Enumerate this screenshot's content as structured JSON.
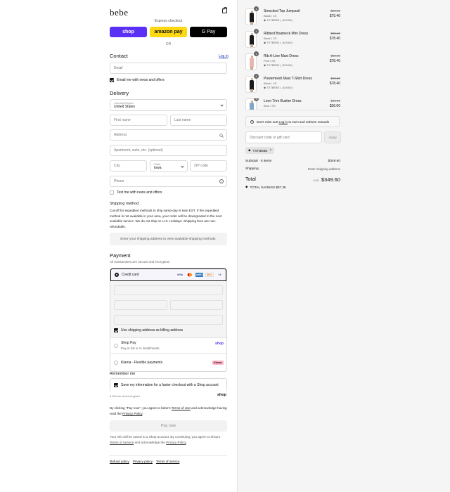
{
  "store": {
    "name": "bebe"
  },
  "express": {
    "label": "Express checkout",
    "shop_pay": "shop",
    "amazon_pay": "amazon pay",
    "google_pay": "G Pay",
    "or": "OR"
  },
  "contact": {
    "heading": "Contact",
    "login": "Log in",
    "email_placeholder": "Email",
    "email_news": "Email me with news and offers"
  },
  "delivery": {
    "heading": "Delivery",
    "country_label": "Country/Region",
    "country_value": "United States",
    "first_name": "First name",
    "last_name": "Last name",
    "address": "Address",
    "apartment": "Apartment, suite, etc. (optional)",
    "city": "City",
    "state_label": "State",
    "state_value": "Iowa",
    "zip": "ZIP code",
    "phone": "Phone",
    "text_news": "Text me with news and offers"
  },
  "shipping": {
    "heading": "Shipping method",
    "notice": "Cut-off for expedited methods to ship same-day is 9am EST. If the expedited method is not available in your area, your order will be downgraded to the next available service. We do not ship on U.S. Holidays. Shipping fees are non-refundable.",
    "placeholder": "Enter your shipping address to view available shipping methods."
  },
  "payment": {
    "heading": "Payment",
    "subtitle": "All transactions are secure and encrypted.",
    "credit_card": "Credit card",
    "brands": [
      "VISA",
      "MC",
      "AMEX",
      "DISC"
    ],
    "more_brands": "+4",
    "billing_same": "Use shipping address as billing address",
    "shop_pay_title": "Shop Pay",
    "shop_pay_sub": "Pay in full or in installments",
    "shop_pay_logo": "shop",
    "klarna": "Klarna - Flexible payments",
    "klarna_logo": "Klarna."
  },
  "remember": {
    "heading": "Remember me",
    "save_info": "Save my information for a faster checkout with a Shop account",
    "secure": "Secure and encrypted",
    "shop_logo": "shop"
  },
  "legal": {
    "terms_pre": "By clicking \"Pay now\", you agree to bebe's ",
    "terms_link": "Terms of Use",
    "terms_mid": " and acknowledge having read the ",
    "privacy_link": "Privacy Policy",
    "terms_post": ".",
    "pay_now": "Pay now",
    "shop_pre": "Your info will be saved to a Shop account. By continuing, you agree to Shop's ",
    "shop_tos": "Terms of Service",
    "shop_mid": " and acknowledge the ",
    "shop_privacy": "Privacy Policy",
    "shop_post": "."
  },
  "footer": {
    "links": [
      "Refund policy",
      "Privacy policy",
      "Terms of service"
    ]
  },
  "cart": {
    "items": [
      {
        "qty": "1",
        "name": "Smocked Top Jumpsuit",
        "variant": "Black / XS",
        "discount": "TXTBEBE ( -$19.80)",
        "old_price": "$99.00",
        "price": "$79.40",
        "color": "#1a1a1a"
      },
      {
        "qty": "1",
        "name": "Ribbed Boatneck Mini Dress",
        "variant": "Black / XS",
        "discount": "TXTBEBE ( -$19.60)",
        "old_price": "$98.00",
        "price": "$78.40",
        "color": "#1a1a1a"
      },
      {
        "qty": "1",
        "name": "Rib A-Line Maxi Dress",
        "variant": "Pink / XS",
        "discount": "TXTBEBE ( -$19.60)",
        "old_price": "$98.00",
        "price": "$78.40",
        "color": "#e7b7b0"
      },
      {
        "qty": "1",
        "name": "Powermesh Maxi T-Shirt Dress",
        "variant": "Black / XS",
        "discount": "TXTBEBE ( -$19.60)",
        "old_price": "$98.00",
        "price": "$78.40",
        "color": "#1a1a1a"
      },
      {
        "qty": "1",
        "name": "Leon Trim Bustier Dress",
        "variant": "Blue / XS",
        "discount": "",
        "old_price": "$44.99",
        "price": "$36.00",
        "color": "#7fa6c8"
      }
    ],
    "rewards": "Don't miss out! ",
    "rewards_link": "Log in",
    "rewards_post": " to earn and redeem rewards",
    "discount_placeholder": "Discount code or gift card",
    "apply": "Apply",
    "applied_code": "TXTBEBE",
    "subtotal_label": "Subtotal · 5 items",
    "subtotal_value": "$349.60",
    "shipping_label": "Shipping",
    "shipping_value": "Enter shipping address",
    "total_label": "Total",
    "currency": "USD",
    "total_value": "$349.60",
    "savings": "TOTAL SAVINGS  $87.39"
  },
  "colors": {
    "shop_purple": "#5a31f4",
    "amazon_yellow": "#ffd814",
    "link_blue": "#1a3dbd",
    "klarna_pink": "#ffb3c7"
  }
}
